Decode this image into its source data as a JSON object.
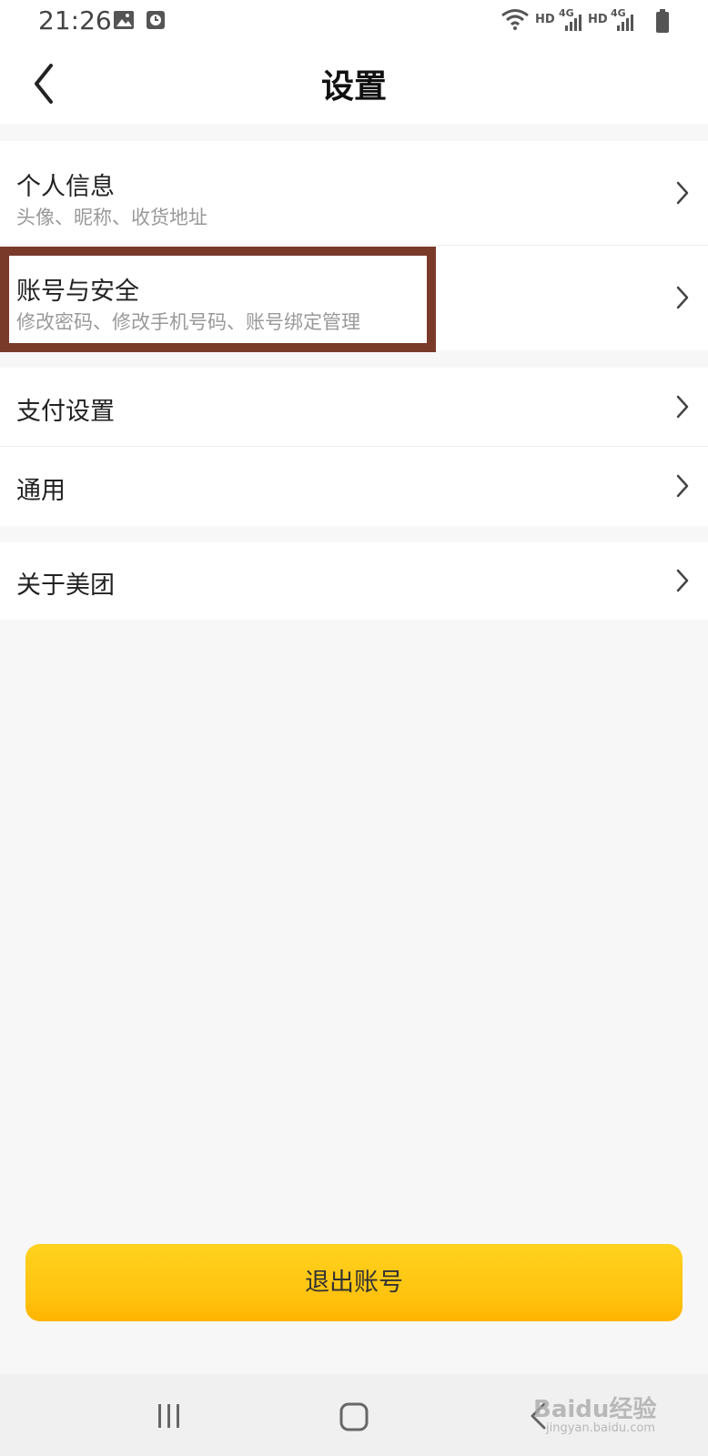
{
  "status_bar": {
    "time": "21:26",
    "left_icons": [
      "image-icon",
      "clock-icon"
    ],
    "right_icons": [
      "wifi-icon",
      "signal-icon",
      "signal-icon",
      "battery-icon"
    ],
    "network_labels": [
      "HD",
      "4G",
      "HD",
      "4G"
    ]
  },
  "header": {
    "title": "设置",
    "back_icon": "chevron-left-icon"
  },
  "groups": [
    {
      "items": [
        {
          "title": "个人信息",
          "subtitle": "头像、昵称、收货地址"
        },
        {
          "title": "账号与安全",
          "subtitle": "修改密码、修改手机号码、账号绑定管理"
        }
      ]
    },
    {
      "items": [
        {
          "title": "支付设置"
        },
        {
          "title": "通用"
        }
      ]
    },
    {
      "items": [
        {
          "title": "关于美团"
        }
      ]
    }
  ],
  "logout_button": {
    "label": "退出账号"
  },
  "system_nav": {
    "icons": [
      "recent-apps-icon",
      "home-icon",
      "back-icon"
    ]
  },
  "watermark": {
    "text": "Baidu经验",
    "sub": "jingyan.baidu.com"
  },
  "colors": {
    "accent_yellow": "#ffc20e",
    "highlight_border": "#7a3a2a",
    "background": "#f7f7f7"
  }
}
